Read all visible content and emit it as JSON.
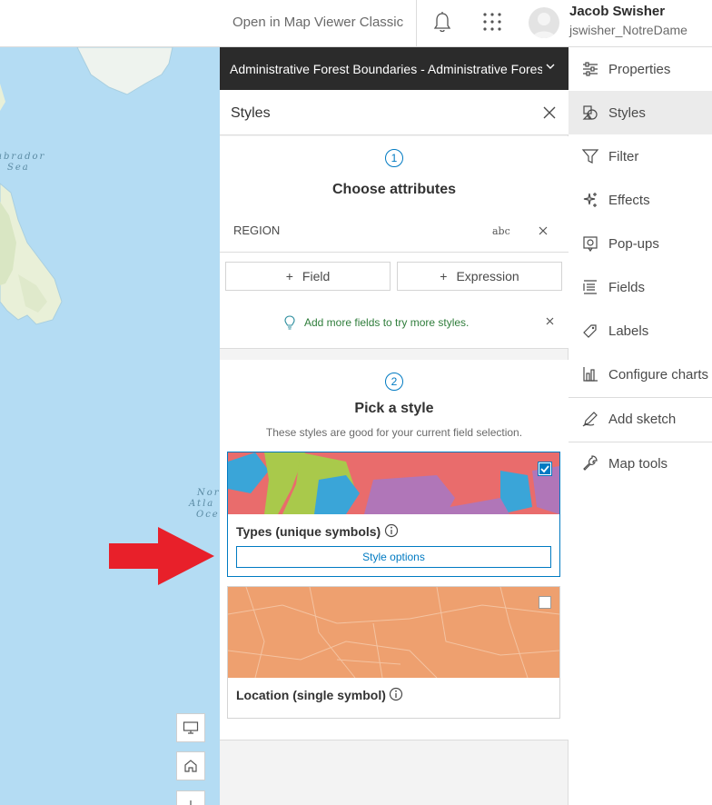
{
  "header": {
    "open_classic": "Open in Map Viewer Classic",
    "user_name": "Jacob Swisher",
    "user_id": "jswisher_NotreDame"
  },
  "map": {
    "labels": [
      "abrador",
      "Sea",
      "Nor",
      "Atla",
      "Oce"
    ]
  },
  "panel": {
    "layer_title": "Administrative Forest Boundaries - Administrative Forest Boundaries",
    "styles_title": "Styles",
    "step1": {
      "number": "1",
      "title": "Choose attributes",
      "attribute_name": "REGION",
      "attribute_type": "abc",
      "field_button": "Field",
      "expression_button": "Expression",
      "notice": "Add more fields to try more styles."
    },
    "step2": {
      "number": "2",
      "title": "Pick a style",
      "subtitle": "These styles are good for your current field selection.",
      "styles": [
        {
          "name": "Types (unique symbols)",
          "selected": true,
          "options_label": "Style options"
        },
        {
          "name": "Location (single symbol)",
          "selected": false
        }
      ]
    }
  },
  "toolbar": {
    "items": [
      {
        "label": "Properties",
        "icon": "sliders-icon"
      },
      {
        "label": "Styles",
        "icon": "styles-icon",
        "active": true
      },
      {
        "label": "Filter",
        "icon": "filter-icon"
      },
      {
        "label": "Effects",
        "icon": "effects-icon"
      },
      {
        "label": "Pop-ups",
        "icon": "popup-icon"
      },
      {
        "label": "Fields",
        "icon": "fields-icon"
      },
      {
        "label": "Labels",
        "icon": "label-icon"
      },
      {
        "label": "Configure charts",
        "icon": "chart-icon"
      },
      {
        "label": "Add sketch",
        "icon": "sketch-icon"
      },
      {
        "label": "Map tools",
        "icon": "wrench-icon"
      }
    ]
  },
  "colors": {
    "accent": "#007ac2",
    "header_dark": "#2b2b2b",
    "ocean": "#b4dcf3",
    "annotation_arrow": "#e8202a"
  }
}
